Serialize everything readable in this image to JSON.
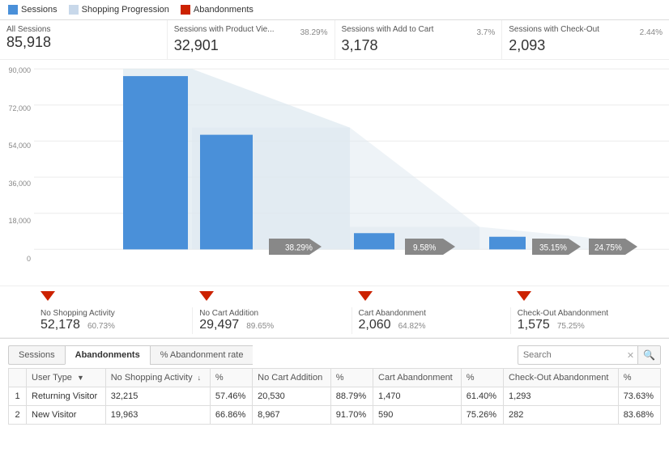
{
  "legend": {
    "items": [
      {
        "label": "Sessions",
        "color": "#4a90d9",
        "type": "solid"
      },
      {
        "label": "Shopping Progression",
        "color": "#c8d8ea",
        "type": "solid"
      },
      {
        "label": "Abandonments",
        "color": "#cc2200",
        "type": "solid"
      }
    ]
  },
  "stats": [
    {
      "label": "All Sessions",
      "value": "85,918",
      "pct": ""
    },
    {
      "label": "Sessions with Product Vie...",
      "value": "32,901",
      "pct": "38.29%"
    },
    {
      "label": "Sessions with Add to Cart",
      "value": "3,178",
      "pct": "3.7%"
    },
    {
      "label": "Sessions with Check-Out",
      "value": "2,093",
      "pct": "2.44%"
    }
  ],
  "yaxis": [
    "90,000",
    "72,000",
    "54,000",
    "36,000",
    "18,000",
    "0"
  ],
  "funnel_labels": [
    "38.29%",
    "9.58%",
    "35.15%",
    "24.75%"
  ],
  "abandonment": [
    {
      "label": "No Shopping Activity",
      "value": "52,178",
      "pct": "60.73%"
    },
    {
      "label": "No Cart Addition",
      "value": "29,497",
      "pct": "89.65%"
    },
    {
      "label": "Cart Abandonment",
      "value": "2,060",
      "pct": "64.82%"
    },
    {
      "label": "Check-Out Abandonment",
      "value": "1,575",
      "pct": "75.25%"
    }
  ],
  "tabs": [
    "Sessions",
    "Abandonments",
    "% Abandonment rate"
  ],
  "active_tab": 1,
  "search_placeholder": "Search",
  "table": {
    "headers": [
      {
        "label": "#",
        "sortable": false
      },
      {
        "label": "User Type",
        "sortable": true
      },
      {
        "label": "No Shopping Activity",
        "sortable": true
      },
      {
        "label": "%",
        "sortable": false
      },
      {
        "label": "No Cart Addition",
        "sortable": false
      },
      {
        "label": "%",
        "sortable": false
      },
      {
        "label": "Cart Abandonment",
        "sortable": false
      },
      {
        "label": "%",
        "sortable": false
      },
      {
        "label": "Check-Out Abandonment",
        "sortable": false
      },
      {
        "label": "%",
        "sortable": false
      }
    ],
    "rows": [
      {
        "num": "1",
        "user_type": "Returning Visitor",
        "no_shop": "32,215",
        "no_shop_pct": "57.46%",
        "no_cart": "20,530",
        "no_cart_pct": "88.79%",
        "cart_aband": "1,470",
        "cart_aband_pct": "61.40%",
        "checkout_aband": "1,293",
        "checkout_aband_pct": "73.63%"
      },
      {
        "num": "2",
        "user_type": "New Visitor",
        "no_shop": "19,963",
        "no_shop_pct": "66.86%",
        "no_cart": "8,967",
        "no_cart_pct": "91.70%",
        "cart_aband": "590",
        "cart_aband_pct": "75.26%",
        "checkout_aband": "282",
        "checkout_aband_pct": "83.68%"
      }
    ]
  }
}
